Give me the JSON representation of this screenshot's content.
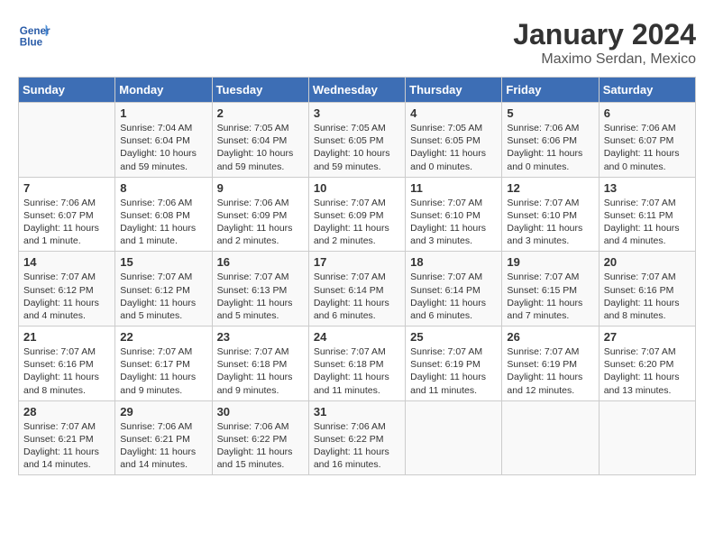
{
  "header": {
    "logo_line1": "General",
    "logo_line2": "Blue",
    "title": "January 2024",
    "subtitle": "Maximo Serdan, Mexico"
  },
  "columns": [
    "Sunday",
    "Monday",
    "Tuesday",
    "Wednesday",
    "Thursday",
    "Friday",
    "Saturday"
  ],
  "weeks": [
    [
      {
        "day": "",
        "info": ""
      },
      {
        "day": "1",
        "info": "Sunrise: 7:04 AM\nSunset: 6:04 PM\nDaylight: 10 hours\nand 59 minutes."
      },
      {
        "day": "2",
        "info": "Sunrise: 7:05 AM\nSunset: 6:04 PM\nDaylight: 10 hours\nand 59 minutes."
      },
      {
        "day": "3",
        "info": "Sunrise: 7:05 AM\nSunset: 6:05 PM\nDaylight: 10 hours\nand 59 minutes."
      },
      {
        "day": "4",
        "info": "Sunrise: 7:05 AM\nSunset: 6:05 PM\nDaylight: 11 hours\nand 0 minutes."
      },
      {
        "day": "5",
        "info": "Sunrise: 7:06 AM\nSunset: 6:06 PM\nDaylight: 11 hours\nand 0 minutes."
      },
      {
        "day": "6",
        "info": "Sunrise: 7:06 AM\nSunset: 6:07 PM\nDaylight: 11 hours\nand 0 minutes."
      }
    ],
    [
      {
        "day": "7",
        "info": "Sunrise: 7:06 AM\nSunset: 6:07 PM\nDaylight: 11 hours\nand 1 minute."
      },
      {
        "day": "8",
        "info": "Sunrise: 7:06 AM\nSunset: 6:08 PM\nDaylight: 11 hours\nand 1 minute."
      },
      {
        "day": "9",
        "info": "Sunrise: 7:06 AM\nSunset: 6:09 PM\nDaylight: 11 hours\nand 2 minutes."
      },
      {
        "day": "10",
        "info": "Sunrise: 7:07 AM\nSunset: 6:09 PM\nDaylight: 11 hours\nand 2 minutes."
      },
      {
        "day": "11",
        "info": "Sunrise: 7:07 AM\nSunset: 6:10 PM\nDaylight: 11 hours\nand 3 minutes."
      },
      {
        "day": "12",
        "info": "Sunrise: 7:07 AM\nSunset: 6:10 PM\nDaylight: 11 hours\nand 3 minutes."
      },
      {
        "day": "13",
        "info": "Sunrise: 7:07 AM\nSunset: 6:11 PM\nDaylight: 11 hours\nand 4 minutes."
      }
    ],
    [
      {
        "day": "14",
        "info": "Sunrise: 7:07 AM\nSunset: 6:12 PM\nDaylight: 11 hours\nand 4 minutes."
      },
      {
        "day": "15",
        "info": "Sunrise: 7:07 AM\nSunset: 6:12 PM\nDaylight: 11 hours\nand 5 minutes."
      },
      {
        "day": "16",
        "info": "Sunrise: 7:07 AM\nSunset: 6:13 PM\nDaylight: 11 hours\nand 5 minutes."
      },
      {
        "day": "17",
        "info": "Sunrise: 7:07 AM\nSunset: 6:14 PM\nDaylight: 11 hours\nand 6 minutes."
      },
      {
        "day": "18",
        "info": "Sunrise: 7:07 AM\nSunset: 6:14 PM\nDaylight: 11 hours\nand 6 minutes."
      },
      {
        "day": "19",
        "info": "Sunrise: 7:07 AM\nSunset: 6:15 PM\nDaylight: 11 hours\nand 7 minutes."
      },
      {
        "day": "20",
        "info": "Sunrise: 7:07 AM\nSunset: 6:16 PM\nDaylight: 11 hours\nand 8 minutes."
      }
    ],
    [
      {
        "day": "21",
        "info": "Sunrise: 7:07 AM\nSunset: 6:16 PM\nDaylight: 11 hours\nand 8 minutes."
      },
      {
        "day": "22",
        "info": "Sunrise: 7:07 AM\nSunset: 6:17 PM\nDaylight: 11 hours\nand 9 minutes."
      },
      {
        "day": "23",
        "info": "Sunrise: 7:07 AM\nSunset: 6:18 PM\nDaylight: 11 hours\nand 9 minutes."
      },
      {
        "day": "24",
        "info": "Sunrise: 7:07 AM\nSunset: 6:18 PM\nDaylight: 11 hours\nand 11 minutes."
      },
      {
        "day": "25",
        "info": "Sunrise: 7:07 AM\nSunset: 6:19 PM\nDaylight: 11 hours\nand 11 minutes."
      },
      {
        "day": "26",
        "info": "Sunrise: 7:07 AM\nSunset: 6:19 PM\nDaylight: 11 hours\nand 12 minutes."
      },
      {
        "day": "27",
        "info": "Sunrise: 7:07 AM\nSunset: 6:20 PM\nDaylight: 11 hours\nand 13 minutes."
      }
    ],
    [
      {
        "day": "28",
        "info": "Sunrise: 7:07 AM\nSunset: 6:21 PM\nDaylight: 11 hours\nand 14 minutes."
      },
      {
        "day": "29",
        "info": "Sunrise: 7:06 AM\nSunset: 6:21 PM\nDaylight: 11 hours\nand 14 minutes."
      },
      {
        "day": "30",
        "info": "Sunrise: 7:06 AM\nSunset: 6:22 PM\nDaylight: 11 hours\nand 15 minutes."
      },
      {
        "day": "31",
        "info": "Sunrise: 7:06 AM\nSunset: 6:22 PM\nDaylight: 11 hours\nand 16 minutes."
      },
      {
        "day": "",
        "info": ""
      },
      {
        "day": "",
        "info": ""
      },
      {
        "day": "",
        "info": ""
      }
    ]
  ]
}
